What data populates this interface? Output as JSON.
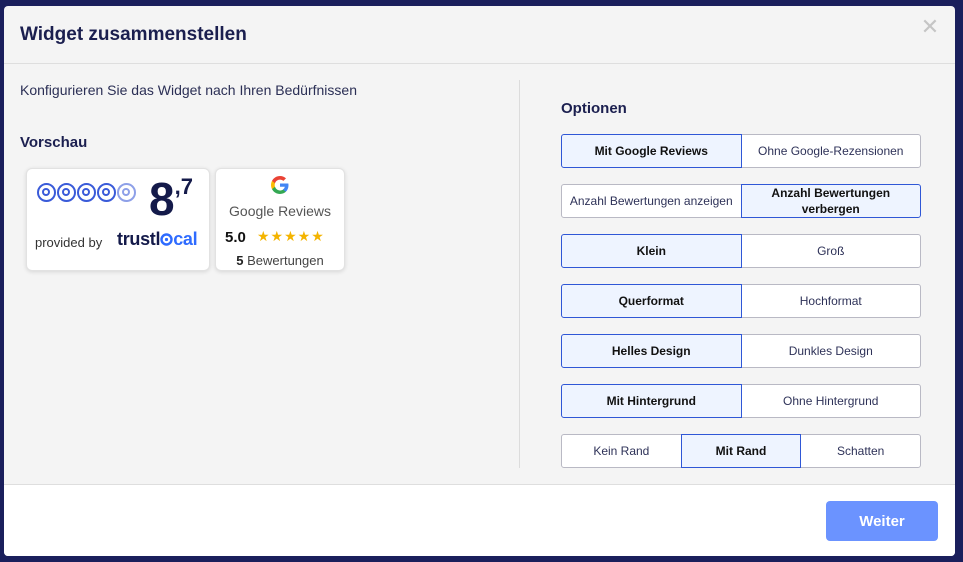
{
  "modal": {
    "title": "Widget zusammenstellen",
    "close_icon": "close-icon",
    "subtitle": "Konfigurieren Sie das Widget nach Ihren Bedürfnissen",
    "preview_heading": "Vorschau"
  },
  "preview": {
    "trustlocal": {
      "score_main": "8",
      "score_decimal": ",7",
      "circles_rating": 4.7,
      "provided_by": "provided by",
      "logo_part1": "trustl",
      "logo_part2": "cal",
      "brand_color": "#2e6bff"
    },
    "google": {
      "title": "Google Reviews",
      "rating": "5.0",
      "stars": "★★★★★",
      "count": "5",
      "count_label": " Bewertungen",
      "star_color": "#f4b400"
    }
  },
  "options": {
    "heading": "Optionen",
    "rows": [
      [
        "Mit Google Reviews",
        "Ohne Google-Rezensionen"
      ],
      [
        "Anzahl Bewertungen anzeigen",
        "Anzahl Bewertungen verbergen"
      ],
      [
        "Klein",
        "Groß"
      ],
      [
        "Querformat",
        "Hochformat"
      ],
      [
        "Helles Design",
        "Dunkles Design"
      ],
      [
        "Mit Hintergrund",
        "Ohne Hintergrund"
      ],
      [
        "Kein Rand",
        "Mit Rand",
        "Schatten"
      ]
    ],
    "active_color": "#2f57d6"
  },
  "footer": {
    "next_label": "Weiter",
    "next_color": "#6b93ff"
  }
}
